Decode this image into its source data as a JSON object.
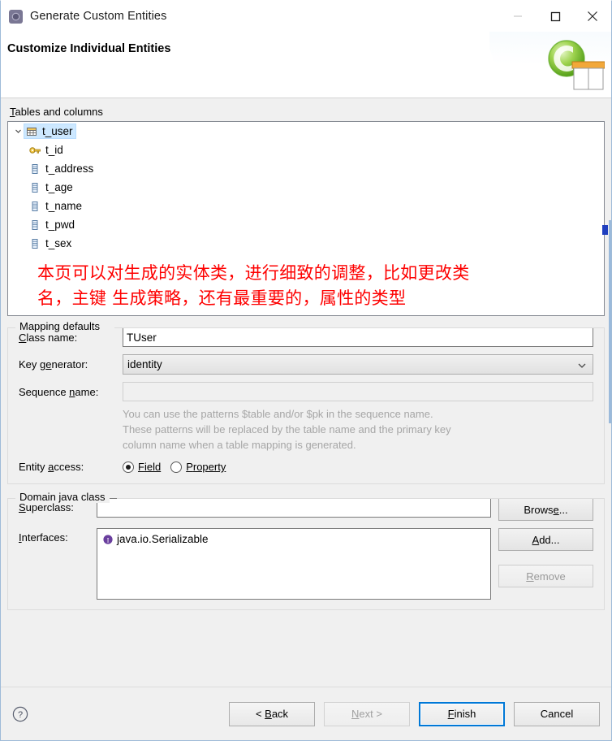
{
  "window": {
    "title": "Generate Custom Entities",
    "app_icon": "gear-circle-icon",
    "minimize_label": "Minimize",
    "maximize_label": "Maximize",
    "close_label": "Close"
  },
  "banner": {
    "heading": "Customize Individual Entities",
    "graphic": "entity-table-wizard-icon"
  },
  "tree_section": {
    "label_prefix": "T",
    "label_rest": "ables and columns",
    "nodes": [
      {
        "label": "t_user",
        "icon": "table-icon",
        "level": 0,
        "expanded": true,
        "selected": true
      },
      {
        "label": "t_id",
        "icon": "key-icon",
        "level": 1,
        "expanded": false,
        "selected": false
      },
      {
        "label": "t_address",
        "icon": "column-icon",
        "level": 1,
        "expanded": false,
        "selected": false
      },
      {
        "label": "t_age",
        "icon": "column-icon",
        "level": 1,
        "expanded": false,
        "selected": false
      },
      {
        "label": "t_name",
        "icon": "column-icon",
        "level": 1,
        "expanded": false,
        "selected": false
      },
      {
        "label": "t_pwd",
        "icon": "column-icon",
        "level": 1,
        "expanded": false,
        "selected": false
      },
      {
        "label": "t_sex",
        "icon": "column-icon",
        "level": 1,
        "expanded": false,
        "selected": false
      }
    ],
    "annotation_line1": "本页可以对生成的实体类，进行细致的调整，比如更改类",
    "annotation_line2": "名，主键 生成策略，还有最重要的，属性的类型",
    "annotation_color": "#fe0000"
  },
  "mapping_defaults": {
    "group_title": "Mapping defaults",
    "class_name": {
      "label_pre": "C",
      "label_post": "lass name:",
      "value": "TUser",
      "placeholder": ""
    },
    "key_generator": {
      "label_pre": "Key g",
      "label_mnem": "e",
      "label_post": "nerator:",
      "value": "identity",
      "options": [
        "identity"
      ]
    },
    "sequence_name": {
      "label_pre": "Sequence ",
      "label_mnem": "n",
      "label_post": "ame:",
      "value": "",
      "placeholder": "",
      "disabled": true
    },
    "hint_line1": "You can use the patterns $table and/or $pk in the sequence name.",
    "hint_line2": "These patterns will be replaced by the table name and the primary key",
    "hint_line3": "column name when a table mapping is generated.",
    "entity_access": {
      "label_pre": "Entity ",
      "label_mnem": "a",
      "label_post": "ccess:",
      "options": [
        {
          "label_mnem": "F",
          "label_rest": "ield",
          "selected": true
        },
        {
          "label_mnem": "P",
          "label_rest": "roperty",
          "selected": false
        }
      ]
    }
  },
  "domain_java_class": {
    "group_title": "Domain java class",
    "superclass": {
      "label_mnem": "S",
      "label_rest": "uperclass:",
      "value": "",
      "placeholder": ""
    },
    "interfaces": {
      "label_mnem": "I",
      "label_rest": "nterfaces:",
      "items": [
        {
          "label": "java.io.Serializable",
          "icon": "interface-icon"
        }
      ]
    },
    "buttons": {
      "browse": {
        "pre": "Brows",
        "mnem": "e",
        "post": "...",
        "enabled": true
      },
      "add": {
        "pre": "",
        "mnem": "A",
        "post": "dd...",
        "enabled": true
      },
      "remove": {
        "pre": "",
        "mnem": "R",
        "post": "emove",
        "enabled": false
      }
    }
  },
  "footer": {
    "help_icon": "help-question-icon",
    "buttons": [
      {
        "name": "back",
        "pre": "< ",
        "mnem": "B",
        "post": "ack",
        "enabled": true,
        "default": false
      },
      {
        "name": "next",
        "pre": "",
        "mnem": "N",
        "post": "ext >",
        "enabled": false,
        "default": false
      },
      {
        "name": "finish",
        "pre": "",
        "mnem": "F",
        "post": "inish",
        "enabled": true,
        "default": true
      },
      {
        "name": "cancel",
        "pre": "",
        "mnem": "",
        "post": "Cancel",
        "enabled": true,
        "default": false
      }
    ]
  },
  "colors": {
    "accent": "#0078d7",
    "annotation": "#fe0000",
    "selection": "#cde8ff",
    "dialog_bg": "#f0f0f0"
  }
}
